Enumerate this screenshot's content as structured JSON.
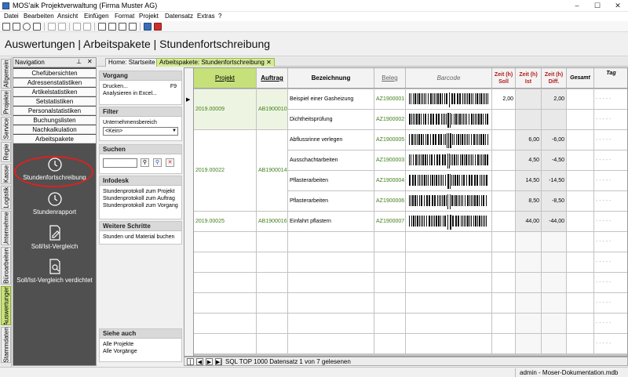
{
  "window": {
    "title": "MOS'aik Projektverwaltung (Firma Muster AG)",
    "minimize": "–",
    "maximize": "☐",
    "close": "✕"
  },
  "menu": [
    "Datei",
    "Bearbeiten",
    "Ansicht",
    "Einfügen",
    "Format",
    "Projekt",
    "Datensatz",
    "Extras",
    "?"
  ],
  "page": {
    "title": "Auswertungen | Arbeitspakete | Stundenfortschreibung"
  },
  "vertical_tabs": [
    "Allgemein",
    "Projekte",
    "Service",
    "Regie",
    "Kasse",
    "Logistik",
    "Unternehmer",
    "Büroarbeiten",
    "Auswertungen",
    "Stammdaten"
  ],
  "navigation": {
    "title": "Navigation",
    "pin": "⊥",
    "close": "✕",
    "items": [
      "Chefübersichten",
      "Adressenstatistiken",
      "Artikelstatistiken",
      "Setstatistiken",
      "Personalstatistiken",
      "Buchungslisten",
      "Nachkalkulation",
      "Arbeitspakete"
    ],
    "big_items": [
      "Stundenfortschreibung",
      "Stundenrapport",
      "Soll/Ist-Vergleich",
      "Soll/Ist-Vergleich verdichtet"
    ]
  },
  "tabs": [
    {
      "label": "Home: Startseite"
    },
    {
      "label": "Arbeitspakete: Stundenfortschreibung",
      "close": "✕"
    }
  ],
  "side": {
    "vorgang": {
      "title": "Vorgang",
      "drucken": "Drucken...",
      "drucken_key": "F9",
      "excel": "Analysieren in Excel..."
    },
    "filter": {
      "title": "Filter",
      "label": "Unternehmensbereich",
      "value": "<Kein>"
    },
    "suchen": {
      "title": "Suchen",
      "value": ""
    },
    "infodesk": {
      "title": "Infodesk",
      "lines": [
        "Stundenprotokoll zum Projekt",
        "Stundenprotokoll zum Auftrag",
        "Stundenprotokoll zum Vorgang"
      ]
    },
    "weitere": {
      "title": "Weitere Schritte",
      "lines": [
        "Stunden und Material buchen"
      ]
    },
    "siehe": {
      "title": "Siehe auch",
      "lines": [
        "Alle Projekte",
        "Alle Vorgänge"
      ]
    }
  },
  "grid": {
    "headers": [
      "Projekt",
      "Auftrag",
      "Bezeichnung",
      "Beleg",
      "Barcode",
      "Zeit (h) Soll",
      "Zeit (h) Ist",
      "Zeit (h) Diff.",
      "Gesamt",
      "Tag"
    ],
    "rows": [
      {
        "bezeichnung": "Beispiel einer Gasheizung",
        "beleg": "AZ1900001",
        "soll": "2,00",
        "ist": "",
        "diff": "2,00"
      },
      {
        "bezeichnung": "Dichtheitsprüfung",
        "beleg": "AZ1900002",
        "soll": "",
        "ist": "",
        "diff": ""
      },
      {
        "bezeichnung": "Abflussrinne verlegen",
        "beleg": "AZ1900005",
        "soll": "",
        "ist": "6,00",
        "diff": "-6,00"
      },
      {
        "bezeichnung": "Ausschachtarbeiten",
        "beleg": "AZ1900003",
        "soll": "",
        "ist": "4,50",
        "diff": "-4,50"
      },
      {
        "bezeichnung": "Pflasterarbeiten",
        "beleg": "AZ1900004",
        "soll": "",
        "ist": "14,50",
        "diff": "-14,50"
      },
      {
        "bezeichnung": "Pflasterarbeiten",
        "beleg": "AZ1900006",
        "soll": "",
        "ist": "8,50",
        "diff": "-8,50"
      },
      {
        "bezeichnung": "Einfahrt pflastern",
        "beleg": "AZ1900007",
        "soll": "",
        "ist": "44,00",
        "diff": "-44,00"
      }
    ],
    "groups": [
      {
        "projekt": "2019.00009",
        "auftrag": "AB1900010"
      },
      {
        "projekt": "2019.00022",
        "auftrag": "AB1900014"
      },
      {
        "projekt": "2019.00025",
        "auftrag": "AB1900016"
      }
    ],
    "tag_placeholder": "- - - - -"
  },
  "recordnav": {
    "first": "|◀",
    "prev": "◀",
    "next": "▶",
    "last": "▶|",
    "text": "SQL TOP 1000 Datensatz 1 von 7 gelesenen"
  },
  "status": {
    "text": "admin - Moser-Dokumentation.mdb"
  },
  "colors": {
    "accent_green": "#c6e07a",
    "header_red": "#b11c1c",
    "value_green": "#3f7f1a",
    "highlight_circle": "#e02020"
  }
}
